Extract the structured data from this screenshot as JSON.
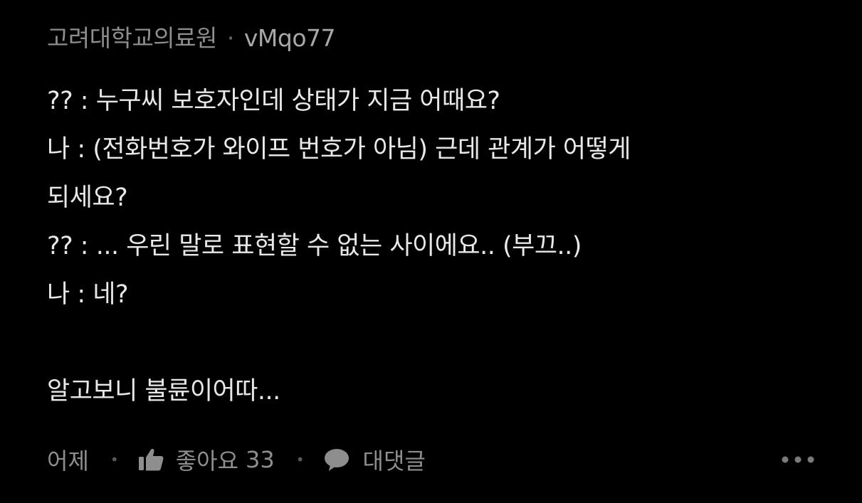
{
  "comment": {
    "author_meta": {
      "affiliation": "고려대학교의료원",
      "separator": "·",
      "username": "vMqo77"
    },
    "lines": [
      "?? : 누구씨 보호자인데 상태가 지금 어때요?",
      "나 : (전화번호가 와이프 번호가 아님) 근데 관계가 어떻게",
      "되세요?",
      "?? : ... 우린 말로 표현할 수 없는 사이에요.. (부끄..)",
      "나 : 네?",
      "",
      "알고보니 불륜이어따..."
    ],
    "footer": {
      "time": "어제",
      "like_label": "좋아요",
      "like_count": "33",
      "reply_label": "대댓글",
      "more_icon": "more-horizontal-icon"
    }
  },
  "colors": {
    "background": "#000000",
    "text": "#e8e8e8",
    "muted": "#8e8e8e"
  }
}
